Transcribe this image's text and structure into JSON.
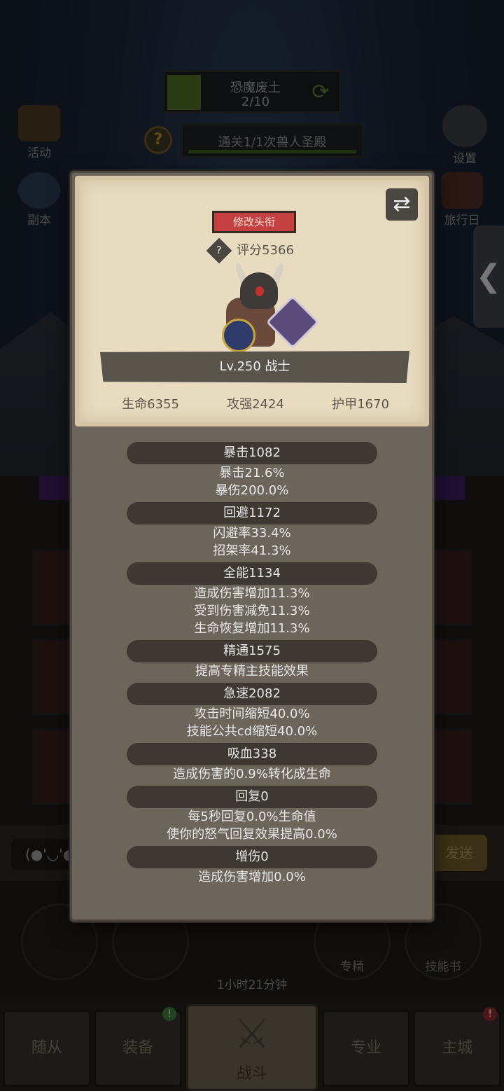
{
  "zone": {
    "name": "恐魔废土",
    "progress": "2/10"
  },
  "quest": {
    "text": "通关1/1次兽人圣殿"
  },
  "side_icons": {
    "activity": "活动",
    "dungeon": "副本",
    "settings": "设置",
    "travel": "旅行日"
  },
  "chat": {
    "input_text": "(●'◡'●",
    "send_label": "发送"
  },
  "skills": {
    "specialization": "专精",
    "skill_book": "技能书",
    "chest_timer": "1小时21分钟"
  },
  "nav": {
    "followers": "随从",
    "equipment": "装备",
    "battle": "战斗",
    "profession": "专业",
    "main_city": "主城"
  },
  "badges": {
    "equipment": "!",
    "main_city": "!"
  },
  "dialog": {
    "title_button": "修改头衔",
    "rating": "评分5366",
    "level": "Lv.250 战士",
    "stats": {
      "hp": "生命6355",
      "attack": "攻强2424",
      "armor": "护甲1670"
    },
    "attributes": [
      {
        "header": "暴击1082",
        "lines": [
          "暴击21.6%",
          "暴伤200.0%"
        ]
      },
      {
        "header": "回避1172",
        "lines": [
          "闪避率33.4%",
          "招架率41.3%"
        ]
      },
      {
        "header": "全能1134",
        "lines": [
          "造成伤害增加11.3%",
          "受到伤害减免11.3%",
          "生命恢复增加11.3%"
        ]
      },
      {
        "header": "精通1575",
        "lines": [
          "提高专精主技能效果"
        ]
      },
      {
        "header": "急速2082",
        "lines": [
          "攻击时间缩短40.0%",
          "技能公共cd缩短40.0%"
        ]
      },
      {
        "header": "吸血338",
        "lines": [
          "造成伤害的0.9%转化成生命"
        ]
      },
      {
        "header": "回复0",
        "lines": [
          "每5秒回复0.0%生命值",
          "使你的怒气回复效果提高0.0%"
        ]
      },
      {
        "header": "增伤0",
        "lines": [
          "造成伤害增加0.0%"
        ]
      }
    ]
  }
}
